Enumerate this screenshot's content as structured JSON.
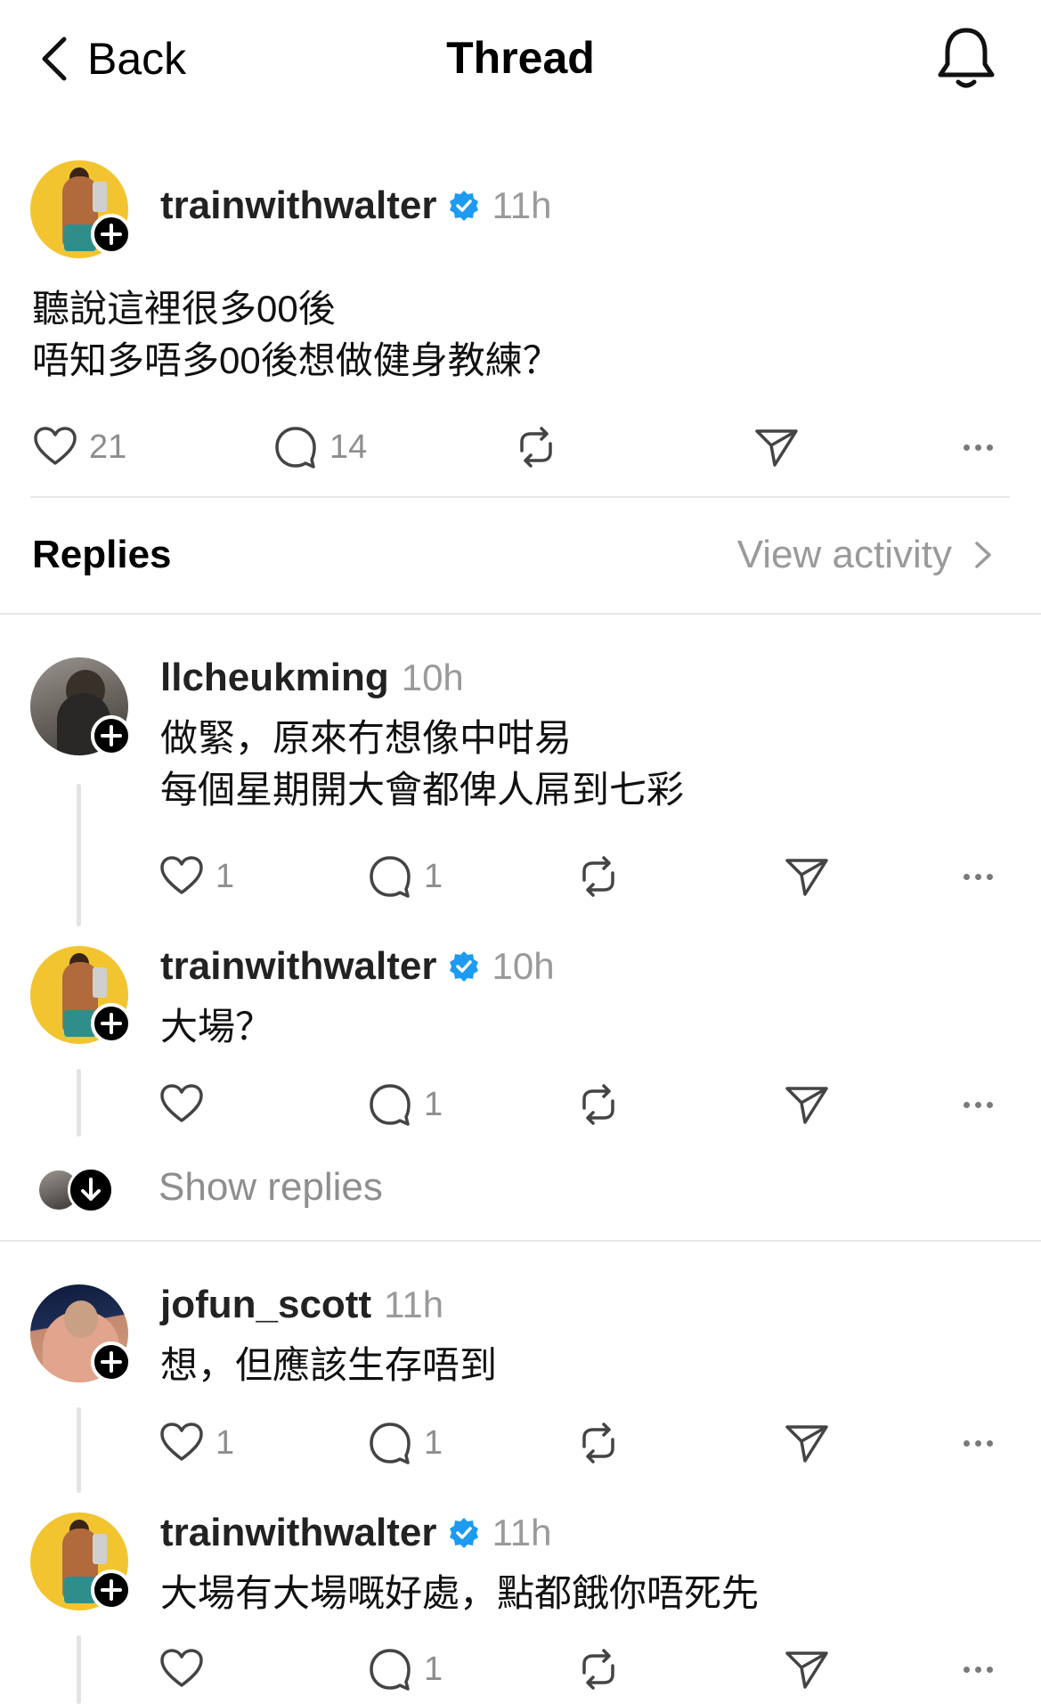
{
  "header": {
    "back_label": "Back",
    "title": "Thread"
  },
  "post": {
    "username": "trainwithwalter",
    "verified": true,
    "time": "11h",
    "lines": [
      "聽說這裡很多00後",
      "唔知多唔多00後想做健身教練？"
    ],
    "likes": "21",
    "comments": "14"
  },
  "replies_section": {
    "label": "Replies",
    "view_activity": "View activity"
  },
  "replies": [
    {
      "username": "llcheukming",
      "time": "10h",
      "lines": [
        "做緊，原來冇想像中咁易",
        "每個星期開大會都俾人屌到七彩"
      ],
      "likes": "1",
      "comments": "1"
    },
    {
      "username": "trainwithwalter",
      "verified": true,
      "time": "10h",
      "lines": [
        "大場？"
      ],
      "likes": "",
      "comments": "1"
    },
    {
      "username": "jofun_scott",
      "time": "11h",
      "lines": [
        "想，但應該生存唔到"
      ],
      "likes": "1",
      "comments": "1"
    },
    {
      "username": "trainwithwalter",
      "verified": true,
      "time": "11h",
      "lines": [
        "大場有大場嘅好處，點都餓你唔死先"
      ],
      "likes": "",
      "comments": "1"
    }
  ],
  "show_replies_label": "Show replies",
  "colors": {
    "verified_blue": "#1d9bf0",
    "muted_text": "#8e8e8e",
    "divider": "#e8e8e8"
  },
  "icons": [
    "chevron-left-icon",
    "bell-icon",
    "heart-icon",
    "comment-icon",
    "repost-icon",
    "share-icon",
    "more-icon",
    "verified-icon",
    "plus-icon",
    "arrow-down-icon",
    "chevron-right-icon"
  ]
}
